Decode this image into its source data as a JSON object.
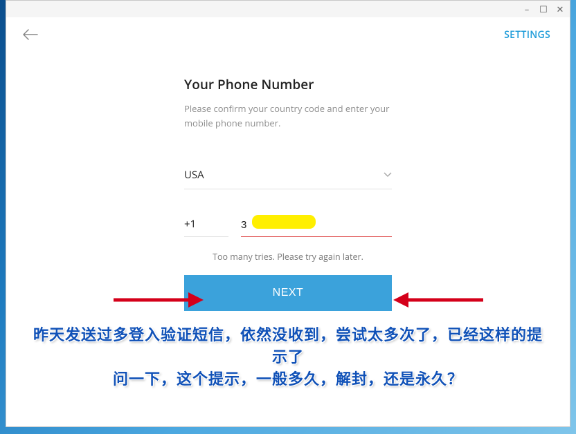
{
  "window": {
    "minimize": "–",
    "maximize": "☐",
    "close": "✕"
  },
  "topbar": {
    "settings": "SETTINGS"
  },
  "form": {
    "title": "Your Phone Number",
    "subtitle": "Please confirm your country code and enter your mobile phone number.",
    "country": "USA",
    "dial_code": "+1",
    "phone_value": "3",
    "error": "Too many tries. Please try again later.",
    "next": "NEXT"
  },
  "caption": {
    "line1": "昨天发送过多登入验证短信，依然没收到，尝试太多次了，已经这样的提示了",
    "line2": "问一下，这个提示，一般多久，解封，还是永久？"
  }
}
